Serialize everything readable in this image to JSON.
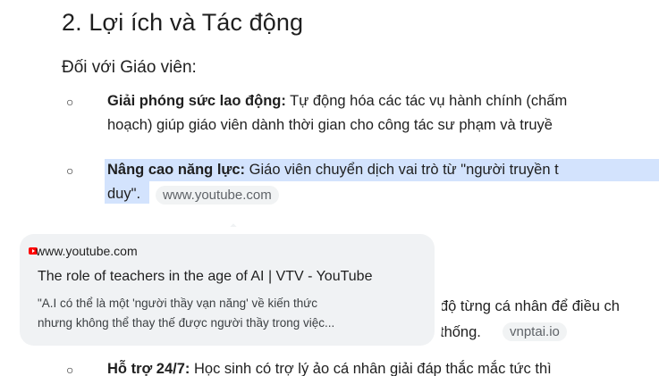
{
  "heading": "2. Lợi ích và Tác động",
  "subheading": "Đối với Giáo viên:",
  "bullet_glyph": "○",
  "items": [
    {
      "bold": "Giải phóng sức lao động:",
      "text1": " Tự động hóa các tác vụ hành chính (chấm",
      "line2": "hoạch) giúp giáo viên dành thời gian cho công tác sư phạm và truyề"
    },
    {
      "bold": "Nâng cao năng lực:",
      "text1": " Giáo viên chuyển dịch vai trò từ \"người truyền t",
      "line2": "duy\".",
      "chip": "www.youtube.com"
    },
    {
      "partial1": "độ từng cá nhân để điều ch",
      "partial2": "thống.",
      "chip": "vnptai.io"
    },
    {
      "bold": "Hỗ trợ 24/7:",
      "text1": " Học sinh có trợ lý ảo cá nhân giải đáp thắc mắc tức thì"
    }
  ],
  "tooltip": {
    "source": "www.youtube.com",
    "title": "The role of teachers in the age of AI | VTV - YouTube",
    "snippet1": "\"A.I có thể là một 'người thầy vạn năng' về kiến thức",
    "snippet2": "nhưng không thể thay thế được người thầy trong việc..."
  }
}
